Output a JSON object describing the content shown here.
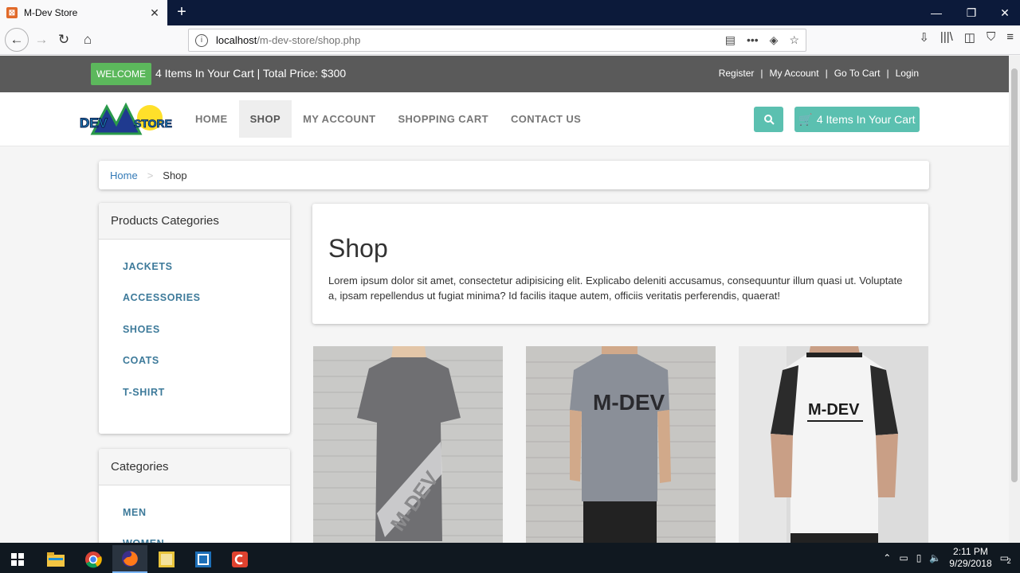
{
  "browser": {
    "tab_title": "M-Dev Store",
    "url_host": "localhost",
    "url_path": "/m-dev-store/shop.php"
  },
  "topbar": {
    "welcome_label": "WELCOME",
    "cart_summary": "4 Items In Your Cart | Total Price: $300",
    "links": [
      "Register",
      "My Account",
      "Go To Cart",
      "Login"
    ]
  },
  "header": {
    "logo_text": "DEV STORE",
    "menu": [
      "HOME",
      "SHOP",
      "MY ACCOUNT",
      "SHOPPING CART",
      "CONTACT US"
    ],
    "active_menu": "SHOP",
    "cart_button": "4 Items In Your Cart",
    "accent_color": "#5bc0b0"
  },
  "breadcrumb": {
    "home": "Home",
    "separator": ">",
    "current": "Shop"
  },
  "product_categories": {
    "title": "Products Categories",
    "items": [
      "JACKETS",
      "ACCESSORIES",
      "SHOES",
      "COATS",
      "T-SHIRT"
    ]
  },
  "categories": {
    "title": "Categories",
    "items": [
      "MEN",
      "WOMEN"
    ]
  },
  "shop": {
    "title": "Shop",
    "description": "Lorem ipsum dolor sit amet, consectetur adipisicing elit. Explicabo deleniti accusamus, consequuntur illum quasi ut. Voluptate a, ipsam repellendus ut fugiat minima? Id facilis itaque autem, officiis veritatis perferendis, quaerat!"
  },
  "products": [
    {
      "print": "M-DEV",
      "shirt_color": "#6f6f72"
    },
    {
      "print": "M-DEV",
      "shirt_color": "#8a8f98"
    },
    {
      "print": "M-DEV",
      "shirt_color": "#f4f4f4"
    }
  ],
  "taskbar": {
    "time": "2:11 PM",
    "date": "9/29/2018",
    "notification_count": "2"
  }
}
